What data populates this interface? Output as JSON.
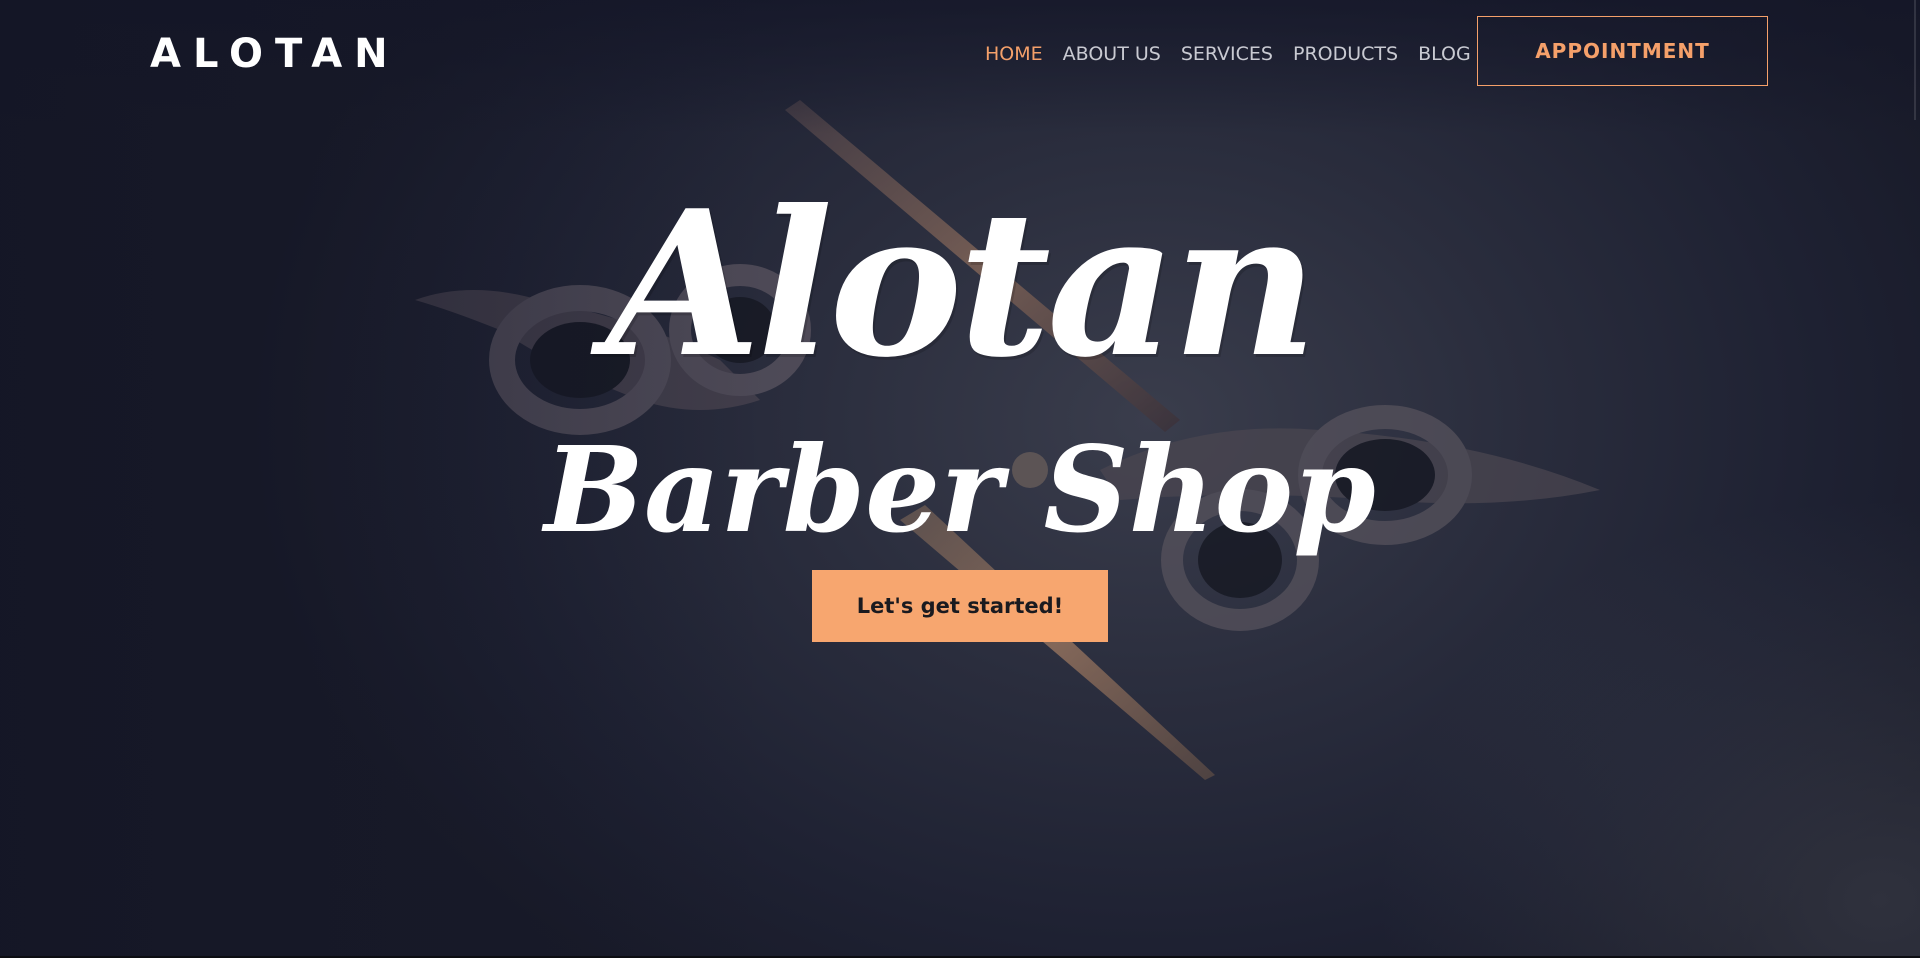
{
  "header": {
    "logo": "ALOTAN",
    "nav": [
      {
        "label": "HOME",
        "active": true
      },
      {
        "label": "ABOUT US",
        "active": false
      },
      {
        "label": "SERVICES",
        "active": false
      },
      {
        "label": "PRODUCTS",
        "active": false
      },
      {
        "label": "BLOG",
        "active": false
      }
    ],
    "appointment_label": "APPOINTMENT"
  },
  "hero": {
    "title_line1": "Alotan",
    "title_line2": "Barber Shop",
    "cta_label": "Let's get started!",
    "background_image": "scissors-icon"
  },
  "colors": {
    "accent": "#f5a06a",
    "cta_background": "#f7a66f",
    "background": "#1e2132",
    "text": "#ffffff",
    "nav_text": "#c9cad2"
  }
}
